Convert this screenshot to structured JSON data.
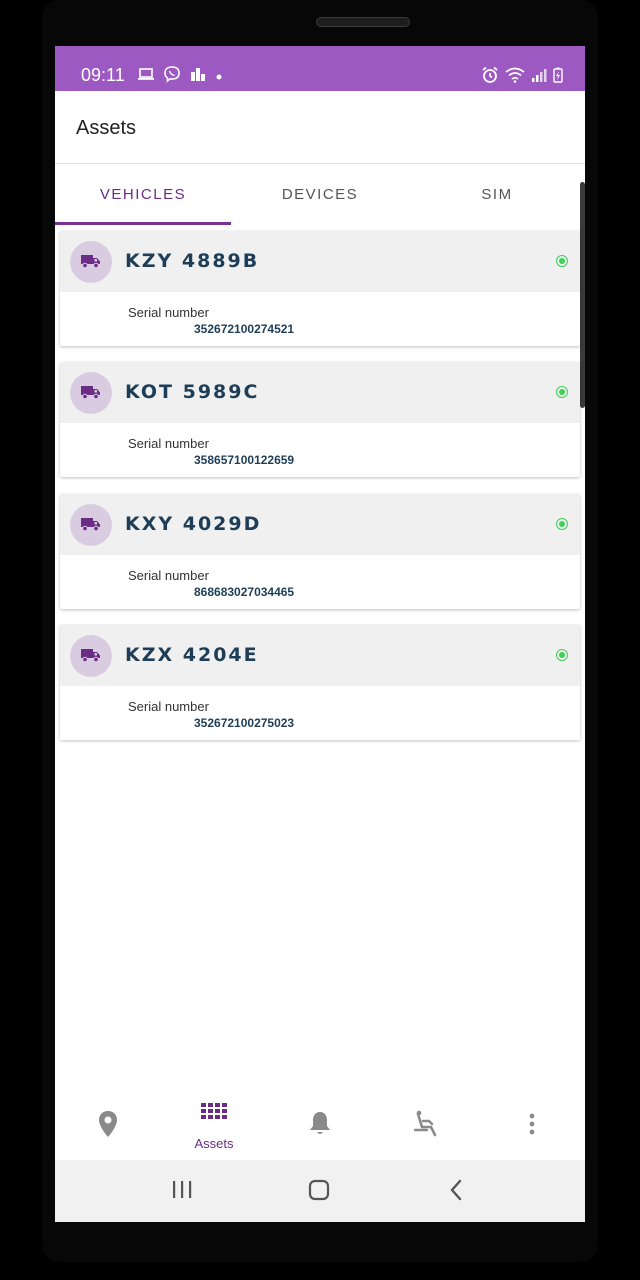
{
  "status": {
    "time": "09:11"
  },
  "appbar": {
    "title": "Assets"
  },
  "tabs": [
    {
      "label": "VEHICLES",
      "active": true
    },
    {
      "label": "DEVICES",
      "active": false
    },
    {
      "label": "SIM",
      "active": false
    }
  ],
  "vehicles": [
    {
      "plate": "KZY 4889B",
      "serial_label": "Serial number",
      "serial": "352672100274521",
      "status_color": "#3fd05a"
    },
    {
      "plate": "KOT 5989C",
      "serial_label": "Serial number",
      "serial": "358657100122659",
      "status_color": "#3fd05a"
    },
    {
      "plate": "KXY 4029D",
      "serial_label": "Serial number",
      "serial": "868683027034465",
      "status_color": "#3fd05a"
    },
    {
      "plate": "KZX 4204E",
      "serial_label": "Serial number",
      "serial": "352672100275023",
      "status_color": "#3fd05a"
    }
  ],
  "bottom_nav": {
    "items": [
      {
        "icon": "map-pin-icon",
        "label": ""
      },
      {
        "icon": "grid-icon",
        "label": "Assets",
        "active": true
      },
      {
        "icon": "bell-icon",
        "label": ""
      },
      {
        "icon": "seat-icon",
        "label": ""
      },
      {
        "icon": "more-vert-icon",
        "label": ""
      }
    ]
  },
  "colors": {
    "primary": "#9c59c2",
    "accent": "#6b2c86",
    "plate_text": "#1e3e57",
    "online": "#3fd05a"
  }
}
